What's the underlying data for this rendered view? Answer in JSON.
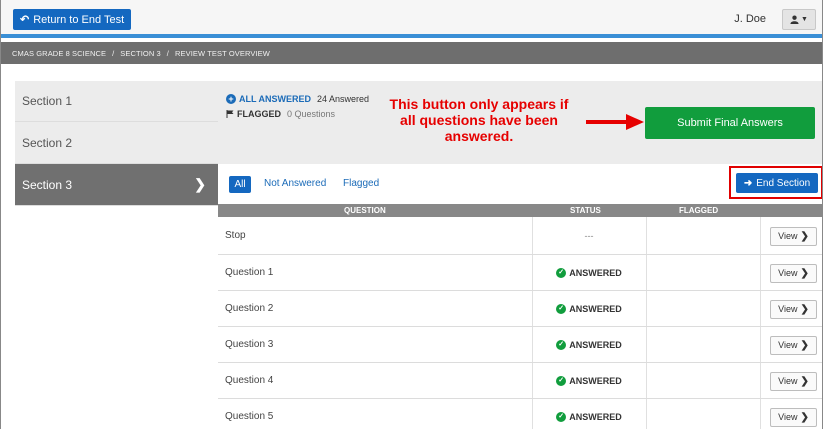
{
  "topbar": {
    "return_label": "Return to End Test",
    "user_name": "J. Doe"
  },
  "breadcrumb": [
    "CMAS GRADE 8 SCIENCE",
    "SECTION 3",
    "REVIEW TEST OVERVIEW"
  ],
  "breadcrumb_separator": "/",
  "sidebar": {
    "sections": [
      {
        "label": "Section 1",
        "active": false
      },
      {
        "label": "Section 2",
        "active": false
      },
      {
        "label": "Section 3",
        "active": true
      }
    ]
  },
  "summary": {
    "all_answered_label": "ALL ANSWERED",
    "all_answered_count": "24 Answered",
    "flagged_label": "FLAGGED",
    "flagged_count": "0 Questions",
    "annotation": "This button only appears if all questions have been answered.",
    "submit_label": "Submit Final Answers"
  },
  "filters": {
    "all": "All",
    "not_answered": "Not Answered",
    "flagged": "Flagged",
    "end_section": "End Section"
  },
  "table": {
    "headers": {
      "question": "QUESTION",
      "status": "STATUS",
      "flagged": "FLAGGED"
    },
    "view_label": "View",
    "rows": [
      {
        "question": "Stop",
        "status": "---"
      },
      {
        "question": "Question 1",
        "status": "ANSWERED"
      },
      {
        "question": "Question 2",
        "status": "ANSWERED"
      },
      {
        "question": "Question 3",
        "status": "ANSWERED"
      },
      {
        "question": "Question 4",
        "status": "ANSWERED"
      },
      {
        "question": "Question 5",
        "status": "ANSWERED"
      }
    ]
  },
  "colors": {
    "primary_blue": "#1468c0",
    "submit_green": "#119d3d",
    "annotation_red": "#e60000",
    "active_section": "#707070"
  },
  "icons": {
    "return": "return-arrow-icon",
    "user": "user-icon",
    "plus": "plus-circle-icon",
    "flag": "flag-icon",
    "check": "check-circle-icon",
    "arrow_right": "arrow-right-icon",
    "chevron": "chevron-right-icon"
  }
}
